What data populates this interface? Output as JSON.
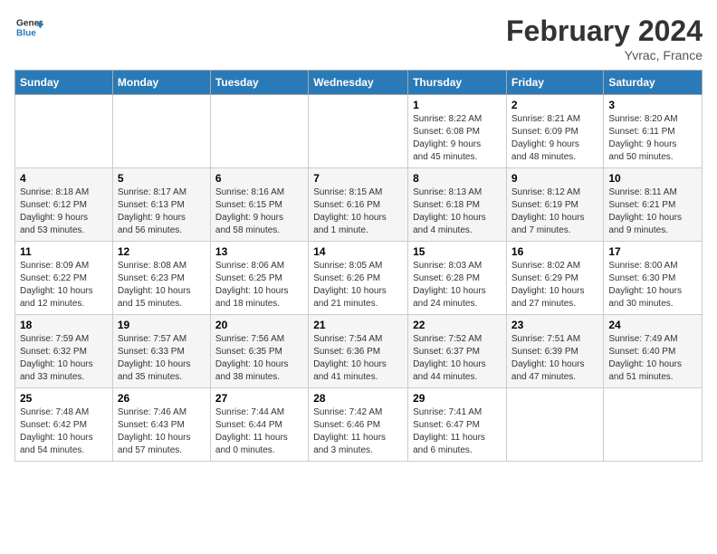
{
  "header": {
    "logo_line1": "General",
    "logo_line2": "Blue",
    "month": "February 2024",
    "location": "Yvrac, France"
  },
  "weekdays": [
    "Sunday",
    "Monday",
    "Tuesday",
    "Wednesday",
    "Thursday",
    "Friday",
    "Saturday"
  ],
  "weeks": [
    [
      {
        "day": "",
        "info": ""
      },
      {
        "day": "",
        "info": ""
      },
      {
        "day": "",
        "info": ""
      },
      {
        "day": "",
        "info": ""
      },
      {
        "day": "1",
        "info": "Sunrise: 8:22 AM\nSunset: 6:08 PM\nDaylight: 9 hours\nand 45 minutes."
      },
      {
        "day": "2",
        "info": "Sunrise: 8:21 AM\nSunset: 6:09 PM\nDaylight: 9 hours\nand 48 minutes."
      },
      {
        "day": "3",
        "info": "Sunrise: 8:20 AM\nSunset: 6:11 PM\nDaylight: 9 hours\nand 50 minutes."
      }
    ],
    [
      {
        "day": "4",
        "info": "Sunrise: 8:18 AM\nSunset: 6:12 PM\nDaylight: 9 hours\nand 53 minutes."
      },
      {
        "day": "5",
        "info": "Sunrise: 8:17 AM\nSunset: 6:13 PM\nDaylight: 9 hours\nand 56 minutes."
      },
      {
        "day": "6",
        "info": "Sunrise: 8:16 AM\nSunset: 6:15 PM\nDaylight: 9 hours\nand 58 minutes."
      },
      {
        "day": "7",
        "info": "Sunrise: 8:15 AM\nSunset: 6:16 PM\nDaylight: 10 hours\nand 1 minute."
      },
      {
        "day": "8",
        "info": "Sunrise: 8:13 AM\nSunset: 6:18 PM\nDaylight: 10 hours\nand 4 minutes."
      },
      {
        "day": "9",
        "info": "Sunrise: 8:12 AM\nSunset: 6:19 PM\nDaylight: 10 hours\nand 7 minutes."
      },
      {
        "day": "10",
        "info": "Sunrise: 8:11 AM\nSunset: 6:21 PM\nDaylight: 10 hours\nand 9 minutes."
      }
    ],
    [
      {
        "day": "11",
        "info": "Sunrise: 8:09 AM\nSunset: 6:22 PM\nDaylight: 10 hours\nand 12 minutes."
      },
      {
        "day": "12",
        "info": "Sunrise: 8:08 AM\nSunset: 6:23 PM\nDaylight: 10 hours\nand 15 minutes."
      },
      {
        "day": "13",
        "info": "Sunrise: 8:06 AM\nSunset: 6:25 PM\nDaylight: 10 hours\nand 18 minutes."
      },
      {
        "day": "14",
        "info": "Sunrise: 8:05 AM\nSunset: 6:26 PM\nDaylight: 10 hours\nand 21 minutes."
      },
      {
        "day": "15",
        "info": "Sunrise: 8:03 AM\nSunset: 6:28 PM\nDaylight: 10 hours\nand 24 minutes."
      },
      {
        "day": "16",
        "info": "Sunrise: 8:02 AM\nSunset: 6:29 PM\nDaylight: 10 hours\nand 27 minutes."
      },
      {
        "day": "17",
        "info": "Sunrise: 8:00 AM\nSunset: 6:30 PM\nDaylight: 10 hours\nand 30 minutes."
      }
    ],
    [
      {
        "day": "18",
        "info": "Sunrise: 7:59 AM\nSunset: 6:32 PM\nDaylight: 10 hours\nand 33 minutes."
      },
      {
        "day": "19",
        "info": "Sunrise: 7:57 AM\nSunset: 6:33 PM\nDaylight: 10 hours\nand 35 minutes."
      },
      {
        "day": "20",
        "info": "Sunrise: 7:56 AM\nSunset: 6:35 PM\nDaylight: 10 hours\nand 38 minutes."
      },
      {
        "day": "21",
        "info": "Sunrise: 7:54 AM\nSunset: 6:36 PM\nDaylight: 10 hours\nand 41 minutes."
      },
      {
        "day": "22",
        "info": "Sunrise: 7:52 AM\nSunset: 6:37 PM\nDaylight: 10 hours\nand 44 minutes."
      },
      {
        "day": "23",
        "info": "Sunrise: 7:51 AM\nSunset: 6:39 PM\nDaylight: 10 hours\nand 47 minutes."
      },
      {
        "day": "24",
        "info": "Sunrise: 7:49 AM\nSunset: 6:40 PM\nDaylight: 10 hours\nand 51 minutes."
      }
    ],
    [
      {
        "day": "25",
        "info": "Sunrise: 7:48 AM\nSunset: 6:42 PM\nDaylight: 10 hours\nand 54 minutes."
      },
      {
        "day": "26",
        "info": "Sunrise: 7:46 AM\nSunset: 6:43 PM\nDaylight: 10 hours\nand 57 minutes."
      },
      {
        "day": "27",
        "info": "Sunrise: 7:44 AM\nSunset: 6:44 PM\nDaylight: 11 hours\nand 0 minutes."
      },
      {
        "day": "28",
        "info": "Sunrise: 7:42 AM\nSunset: 6:46 PM\nDaylight: 11 hours\nand 3 minutes."
      },
      {
        "day": "29",
        "info": "Sunrise: 7:41 AM\nSunset: 6:47 PM\nDaylight: 11 hours\nand 6 minutes."
      },
      {
        "day": "",
        "info": ""
      },
      {
        "day": "",
        "info": ""
      }
    ]
  ]
}
